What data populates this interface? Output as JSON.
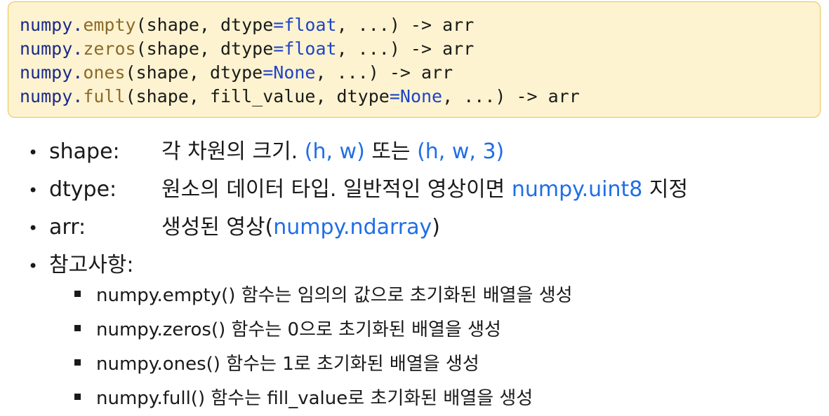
{
  "code": {
    "lines": [
      {
        "mod": "numpy.",
        "fn": "empty",
        "p1": "(shape, dtype",
        "op": "=",
        "val": "float",
        "p2": ", ...) -> arr"
      },
      {
        "mod": "numpy.",
        "fn": "zeros",
        "p1": "(shape, dtype",
        "op": "=",
        "val": "float",
        "p2": ", ...) -> arr"
      },
      {
        "mod": "numpy.",
        "fn": "ones",
        "p1": "(shape, dtype",
        "op": "=",
        "val": "None",
        "p2": ", ...) -> arr"
      },
      {
        "mod": "numpy.",
        "fn": "full",
        "p1": "(shape, fill_value, dtype",
        "op": "=",
        "val": "None",
        "p2": ", ...) -> arr"
      }
    ]
  },
  "params": [
    {
      "key": "shape:",
      "desc": "각 차원의 크기. ",
      "hl1": "(h, w)",
      "mid": " 또는 ",
      "hl2": "(h, w, 3)",
      "tail": ""
    },
    {
      "key": "dtype:",
      "desc": "원소의 데이터 타입. 일반적인 영상이면 ",
      "hl1": "numpy.uint8",
      "mid": " 지정",
      "hl2": "",
      "tail": ""
    },
    {
      "key": "arr:",
      "desc": "생성된 영상(",
      "hl1": "numpy.ndarray",
      "mid": ")",
      "hl2": "",
      "tail": ""
    }
  ],
  "notes_heading": "참고사항:",
  "notes": [
    "numpy.empty() 함수는 임의의 값으로 초기화된 배열을 생성",
    "numpy.zeros() 함수는 0으로 초기화된 배열을 생성",
    "numpy.ones() 함수는 1로 초기화된 배열을 생성",
    "numpy.full() 함수는 fill_value로 초기화된 배열을 생성"
  ],
  "bullet_glyph": "•",
  "colors": {
    "box_bg": "#fdf3d0",
    "box_border": "#e9c24d",
    "highlight_blue": "#1f6ee6",
    "code_value_blue": "#1f43c7",
    "code_fn_brown": "#8a6a2a"
  }
}
